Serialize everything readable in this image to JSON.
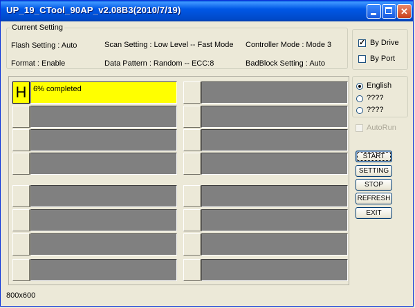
{
  "window": {
    "title": "UP_19_CTool_90AP_v2.08B3(2010/7/19)"
  },
  "current_setting": {
    "legend": "Current Setting",
    "flash_setting": "Flash Setting : Auto",
    "scan_setting": "Scan Setting : Low Level -- Fast Mode",
    "controller_mode": "Controller Mode : Mode 3",
    "format": "Format : Enable",
    "data_pattern": "Data Pattern : Random -- ECC:8",
    "badblock_setting": "BadBlock Setting : Auto"
  },
  "drive_options": [
    {
      "label": "By Drive",
      "checked": true
    },
    {
      "label": "By Port",
      "checked": false
    }
  ],
  "languages": [
    {
      "label": "English",
      "selected": true
    },
    {
      "label": "????",
      "selected": false
    },
    {
      "label": "????",
      "selected": false
    }
  ],
  "autorun": {
    "label": "AutoRun",
    "checked": false,
    "disabled": true
  },
  "actions": [
    "START",
    "SETTING",
    "STOP",
    "REFRESH",
    "EXIT"
  ],
  "slots": [
    {
      "letter": "H",
      "status": "6% completed",
      "active": true,
      "progress_percent": 6
    },
    {
      "letter": "",
      "status": "",
      "active": false
    },
    {
      "letter": "",
      "status": "",
      "active": false
    },
    {
      "letter": "",
      "status": "",
      "active": false
    },
    {
      "letter": "",
      "status": "",
      "active": false
    },
    {
      "letter": "",
      "status": "",
      "active": false
    },
    {
      "letter": "",
      "status": "",
      "active": false
    },
    {
      "letter": "",
      "status": "",
      "active": false
    },
    {
      "letter": "",
      "status": "",
      "active": false
    },
    {
      "letter": "",
      "status": "",
      "active": false
    },
    {
      "letter": "",
      "status": "",
      "active": false
    },
    {
      "letter": "",
      "status": "",
      "active": false
    },
    {
      "letter": "",
      "status": "",
      "active": false
    },
    {
      "letter": "",
      "status": "",
      "active": false
    },
    {
      "letter": "",
      "status": "",
      "active": false
    },
    {
      "letter": "",
      "status": "",
      "active": false
    }
  ],
  "statusbar": {
    "resolution": "800x600"
  }
}
